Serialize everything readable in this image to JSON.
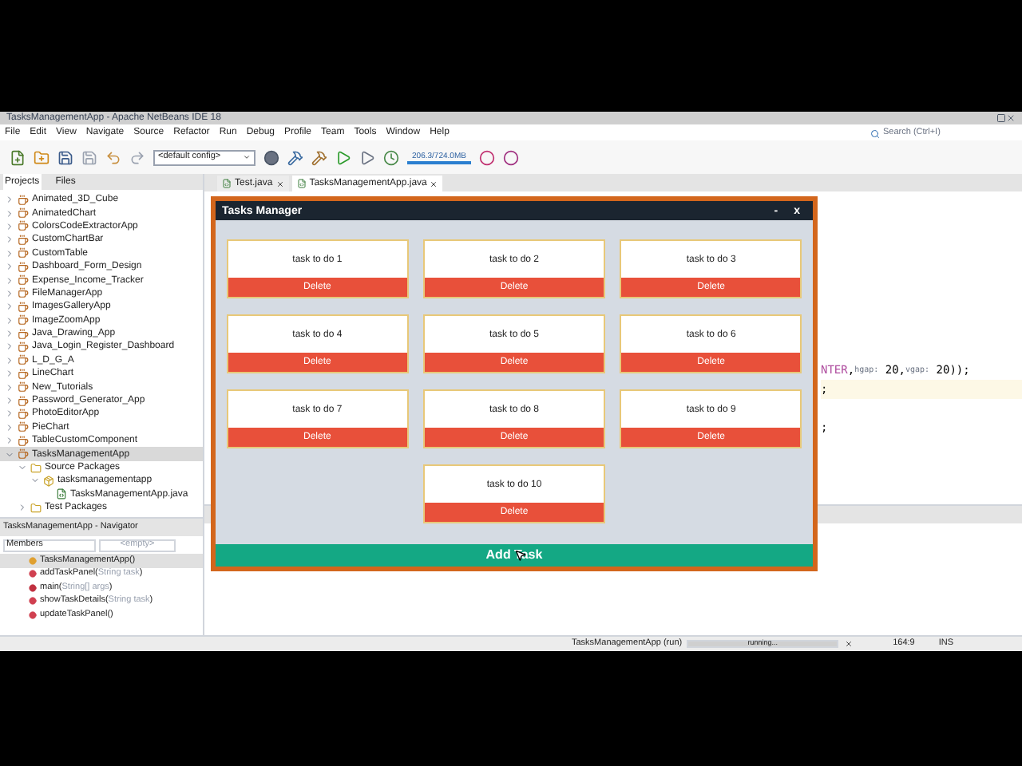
{
  "window": {
    "title": "TasksManagementApp - Apache NetBeans IDE 18"
  },
  "menu": [
    "File",
    "Edit",
    "View",
    "Navigate",
    "Source",
    "Refactor",
    "Run",
    "Debug",
    "Profile",
    "Team",
    "Tools",
    "Window",
    "Help"
  ],
  "toolbar": {
    "config": "<default config>",
    "memory": "206.3/724.0MB"
  },
  "search": {
    "placeholder": "Search (Ctrl+I)"
  },
  "projects": {
    "tabs": [
      {
        "label": "Projects",
        "selected": true
      },
      {
        "label": "Files",
        "selected": false
      }
    ],
    "items": [
      {
        "label": "Animated_3D_Cube",
        "kind": "project",
        "expanded": false,
        "selected": false
      },
      {
        "label": "AnimatedChart",
        "kind": "project",
        "expanded": false,
        "selected": false
      },
      {
        "label": "ColorsCodeExtractorApp",
        "kind": "project",
        "expanded": false,
        "selected": false
      },
      {
        "label": "CustomChartBar",
        "kind": "project",
        "expanded": false,
        "selected": false
      },
      {
        "label": "CustomTable",
        "kind": "project",
        "expanded": false,
        "selected": false
      },
      {
        "label": "Dashboard_Form_Design",
        "kind": "project",
        "expanded": false,
        "selected": false
      },
      {
        "label": "Expense_Income_Tracker",
        "kind": "project",
        "expanded": false,
        "selected": false
      },
      {
        "label": "FileManagerApp",
        "kind": "project",
        "expanded": false,
        "selected": false
      },
      {
        "label": "ImagesGalleryApp",
        "kind": "project",
        "expanded": false,
        "selected": false
      },
      {
        "label": "ImageZoomApp",
        "kind": "project",
        "expanded": false,
        "selected": false
      },
      {
        "label": "Java_Drawing_App",
        "kind": "project",
        "expanded": false,
        "selected": false
      },
      {
        "label": "Java_Login_Register_Dashboard",
        "kind": "project",
        "expanded": false,
        "selected": false
      },
      {
        "label": "L_D_G_A",
        "kind": "project",
        "expanded": false,
        "selected": false
      },
      {
        "label": "LineChart",
        "kind": "project",
        "expanded": false,
        "selected": false
      },
      {
        "label": "New_Tutorials",
        "kind": "project",
        "expanded": false,
        "selected": false
      },
      {
        "label": "Password_Generator_App",
        "kind": "project",
        "expanded": false,
        "selected": false
      },
      {
        "label": "PhotoEditorApp",
        "kind": "project",
        "expanded": false,
        "selected": false
      },
      {
        "label": "PieChart",
        "kind": "project",
        "expanded": false,
        "selected": false
      },
      {
        "label": "TableCustomComponent",
        "kind": "project",
        "expanded": false,
        "selected": false
      },
      {
        "label": "TasksManagementApp",
        "kind": "project",
        "expanded": true,
        "selected": true,
        "children": [
          {
            "label": "Source Packages",
            "kind": "folder",
            "expanded": true,
            "selected": false,
            "children": [
              {
                "label": "tasksmanagementapp",
                "kind": "package",
                "expanded": true,
                "selected": false,
                "children": [
                  {
                    "label": "TasksManagementApp.java",
                    "kind": "file",
                    "selected": false
                  }
                ]
              }
            ]
          },
          {
            "label": "Test Packages",
            "kind": "folder",
            "expanded": false,
            "selected": false
          }
        ]
      }
    ]
  },
  "navigator": {
    "title": "TasksManagementApp - Navigator",
    "filter": "Members",
    "scope": "<empty>",
    "members": [
      {
        "name": "TasksManagementApp(",
        "close": ")",
        "kind": "constructor",
        "selected": true
      },
      {
        "name": "addTaskPanel(",
        "params": "String task",
        "close": ")",
        "kind": "method",
        "selected": false
      },
      {
        "name": "main(",
        "params": "String[] args",
        "close": ")",
        "kind": "static",
        "selected": false
      },
      {
        "name": "showTaskDetails(",
        "params": "String task",
        "close": ")",
        "kind": "method",
        "selected": false
      },
      {
        "name": "updateTaskPanel(",
        "close": ")",
        "kind": "method",
        "selected": false
      }
    ]
  },
  "editor": {
    "tabs": [
      {
        "label": "Test.java",
        "selected": false
      },
      {
        "label": "TasksManagementApp.java",
        "selected": true
      }
    ],
    "lines": [
      {
        "current": false,
        "parts": [
          {
            "kind": "constant",
            "text": "NTER"
          },
          {
            "kind": "plain",
            "text": ","
          },
          {
            "kind": "hint",
            "text": "hgap:"
          },
          {
            "kind": "plain",
            "text": " 20,"
          },
          {
            "kind": "hint",
            "text": "vgap:"
          },
          {
            "kind": "plain",
            "text": " 20));"
          }
        ]
      },
      {
        "current": true,
        "parts": [
          {
            "kind": "plain",
            "text": ";"
          }
        ]
      },
      {
        "current": false,
        "parts": [
          {
            "kind": "plain",
            "text": ";"
          }
        ]
      }
    ]
  },
  "status_bar": {
    "task": "TasksManagementApp (run)",
    "progress": {
      "text": "running...",
      "level": 1
    },
    "position": "164:9",
    "mode": "INS"
  },
  "dialog": {
    "title": "Tasks Manager",
    "minimize": "-",
    "close": "x",
    "tasks": [
      {
        "label": "task to do 1",
        "button": "Delete"
      },
      {
        "label": "task to do 2",
        "button": "Delete"
      },
      {
        "label": "task to do 3",
        "button": "Delete"
      },
      {
        "label": "task to do 4",
        "button": "Delete"
      },
      {
        "label": "task to do 5",
        "button": "Delete"
      },
      {
        "label": "task to do 6",
        "button": "Delete"
      },
      {
        "label": "task to do 7",
        "button": "Delete"
      },
      {
        "label": "task to do 8",
        "button": "Delete"
      },
      {
        "label": "task to do 9",
        "button": "Delete"
      },
      {
        "label": "task to do 10",
        "button": "Delete"
      }
    ],
    "add_button": "Add Task"
  }
}
